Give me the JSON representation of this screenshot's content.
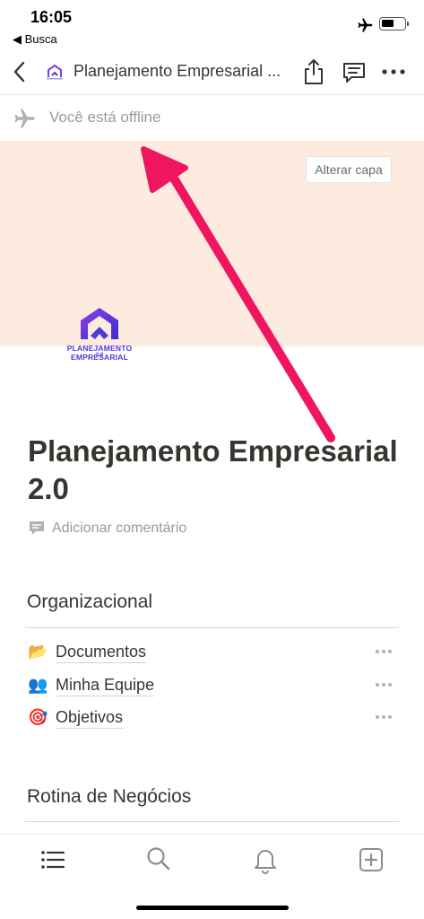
{
  "status_bar": {
    "time": "16:05",
    "back_app": "◀ Busca",
    "battery_level": 0.55
  },
  "nav": {
    "title": "Planejamento Empresarial ..."
  },
  "offline_banner": {
    "text": "Você está offline"
  },
  "cover": {
    "change_button": "Alterar capa",
    "color": "#fdebe0",
    "logo_text": "PLANEJAMENTO EMPRESARIAL",
    "logo_subtext": "2.0"
  },
  "page": {
    "title": "Planejamento Empresarial 2.0",
    "add_comment": "Adicionar comentário"
  },
  "sections": [
    {
      "heading": "Organizacional",
      "items": [
        {
          "icon": "📂",
          "icon_name": "folder-icon",
          "label": "Documentos"
        },
        {
          "icon": "👥",
          "icon_name": "people-icon",
          "label": "Minha Equipe"
        },
        {
          "icon": "🎯",
          "icon_name": "target-icon",
          "label": "Objetivos"
        }
      ]
    },
    {
      "heading": "Rotina de Negócios",
      "items": []
    }
  ],
  "tab_bar": {
    "items": [
      {
        "icon_name": "list-icon"
      },
      {
        "icon_name": "search-icon"
      },
      {
        "icon_name": "bell-icon"
      },
      {
        "icon_name": "new-page-icon"
      }
    ]
  },
  "annotation": {
    "arrow_color": "#f0155f"
  }
}
